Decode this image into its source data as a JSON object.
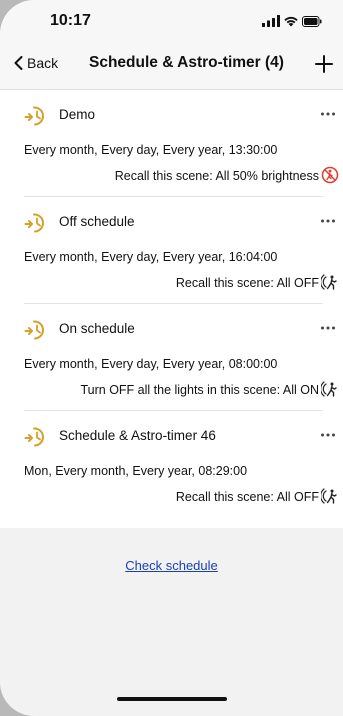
{
  "status_bar": {
    "time": "10:17",
    "icons": [
      "signal-icon",
      "wifi-icon",
      "battery-icon"
    ]
  },
  "nav": {
    "back_label": "Back",
    "title": "Schedule & Astro-timer (4)",
    "add_icon": "plus-icon"
  },
  "accent_color": "#d4a12a",
  "schedules": [
    {
      "name": "Demo",
      "frequency": "Every month, Every day, Every year, 13:30:00",
      "action": "Recall this scene: All 50% brightness",
      "action_icon": "presence-disabled-icon"
    },
    {
      "name": "Off schedule",
      "frequency": "Every month, Every day, Every year, 16:04:00",
      "action": "Recall this scene: All OFF",
      "action_icon": "presence-icon"
    },
    {
      "name": "On schedule",
      "frequency": "Every month, Every day, Every year, 08:00:00",
      "action": "Turn OFF all the lights in this scene: All ON",
      "action_icon": "presence-icon"
    },
    {
      "name": "Schedule & Astro-timer 46",
      "frequency": "Mon, Every month, Every year, 08:29:00",
      "action": "Recall this scene: All OFF",
      "action_icon": "presence-icon"
    }
  ],
  "footer": {
    "check_schedule_label": "Check schedule"
  }
}
